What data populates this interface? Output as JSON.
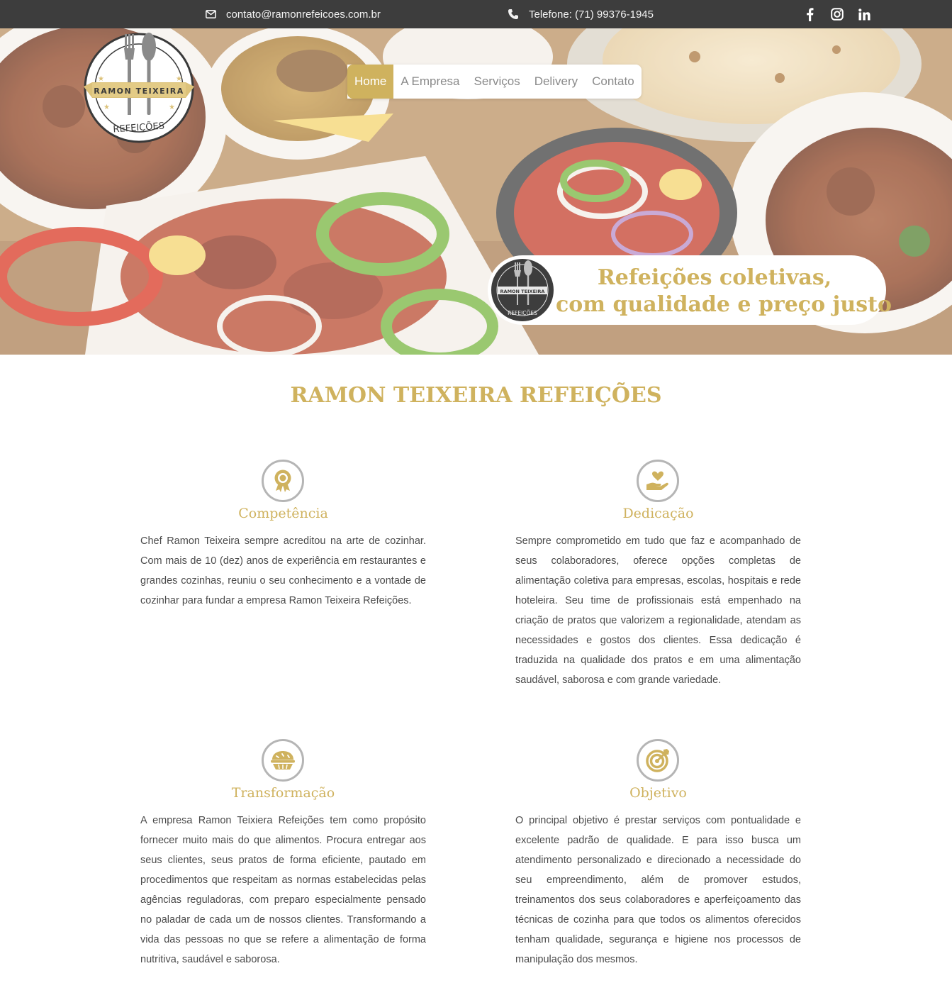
{
  "topbar": {
    "email_icon": "envelope-icon",
    "email": "contato@ramonrefeicoes.com.br",
    "phone_icon": "phone-icon",
    "phone": "Telefone: (71) 99376-1945",
    "social": [
      "facebook-icon",
      "instagram-icon",
      "linkedin-icon"
    ]
  },
  "logo": {
    "name": "RAMON TEIXEIRA",
    "sub": "REFEIÇÕES"
  },
  "nav": {
    "items": [
      "Home",
      "A Empresa",
      "Serviços",
      "Delivery",
      "Contato"
    ],
    "active": "Home"
  },
  "hero": {
    "slogan_line1": "Refeições coletivas,",
    "slogan_line2": "com qualidade e preço justo"
  },
  "section": {
    "title": "RAMON TEIXEIRA REFEIÇÕES"
  },
  "features": [
    {
      "icon": "award-icon",
      "title": "Competência",
      "text": "Chef Ramon Teixeira sempre acreditou na arte de cozinhar. Com mais de 10 (dez) anos de experiência em restaurantes e grandes cozinhas, reuniu o seu conhecimento e a vontade de cozinhar para fundar a empresa Ramon Teixeira Refeições."
    },
    {
      "icon": "hand-heart-icon",
      "title": "Dedicação",
      "text": "Sempre comprometido em tudo que faz e acompanhado de seus colaboradores, oferece opções completas de alimentação coletiva para empresas, escolas, hospitais e rede hoteleira. Seu time de profissionais está empenhado na criação de pratos que valorizem a regionalidade, atendam as necessidades e gostos dos clientes. Essa dedicação é traduzida na qualidade dos pratos e em uma alimentação saudável, saborosa e com grande variedade."
    },
    {
      "icon": "pie-icon",
      "title": "Transformação",
      "text": "A empresa Ramon Teixiera Refeições tem como propósito fornecer muito mais do que alimentos. Procura entregar aos seus clientes, seus pratos de forma eficiente, pautado em procedimentos que respeitam as normas estabelecidas pelas agências reguladoras, com preparo especialmente pensado no paladar de cada um de nossos clientes. Transformando a vida das pessoas no que se refere a alimentação de forma nutritiva, saudável e saborosa."
    },
    {
      "icon": "target-icon",
      "title": "Objetivo",
      "text": "O principal objetivo é prestar serviços com pontualidade e excelente padrão de qualidade. E para isso busca um atendimento personalizado e direcionado a necessidade do seu empreendimento, além de promover estudos, treinamentos dos seus colaboradores e aperfeiçoamento das técnicas de cozinha para que todos os alimentos oferecidos tenham qualidade, segurança e higiene nos processos de manipulação dos mesmos."
    }
  ],
  "colors": {
    "brand_gold": "#cfb25e",
    "topbar": "#3d3d3d",
    "icon_ring": "#b5b5b5"
  }
}
